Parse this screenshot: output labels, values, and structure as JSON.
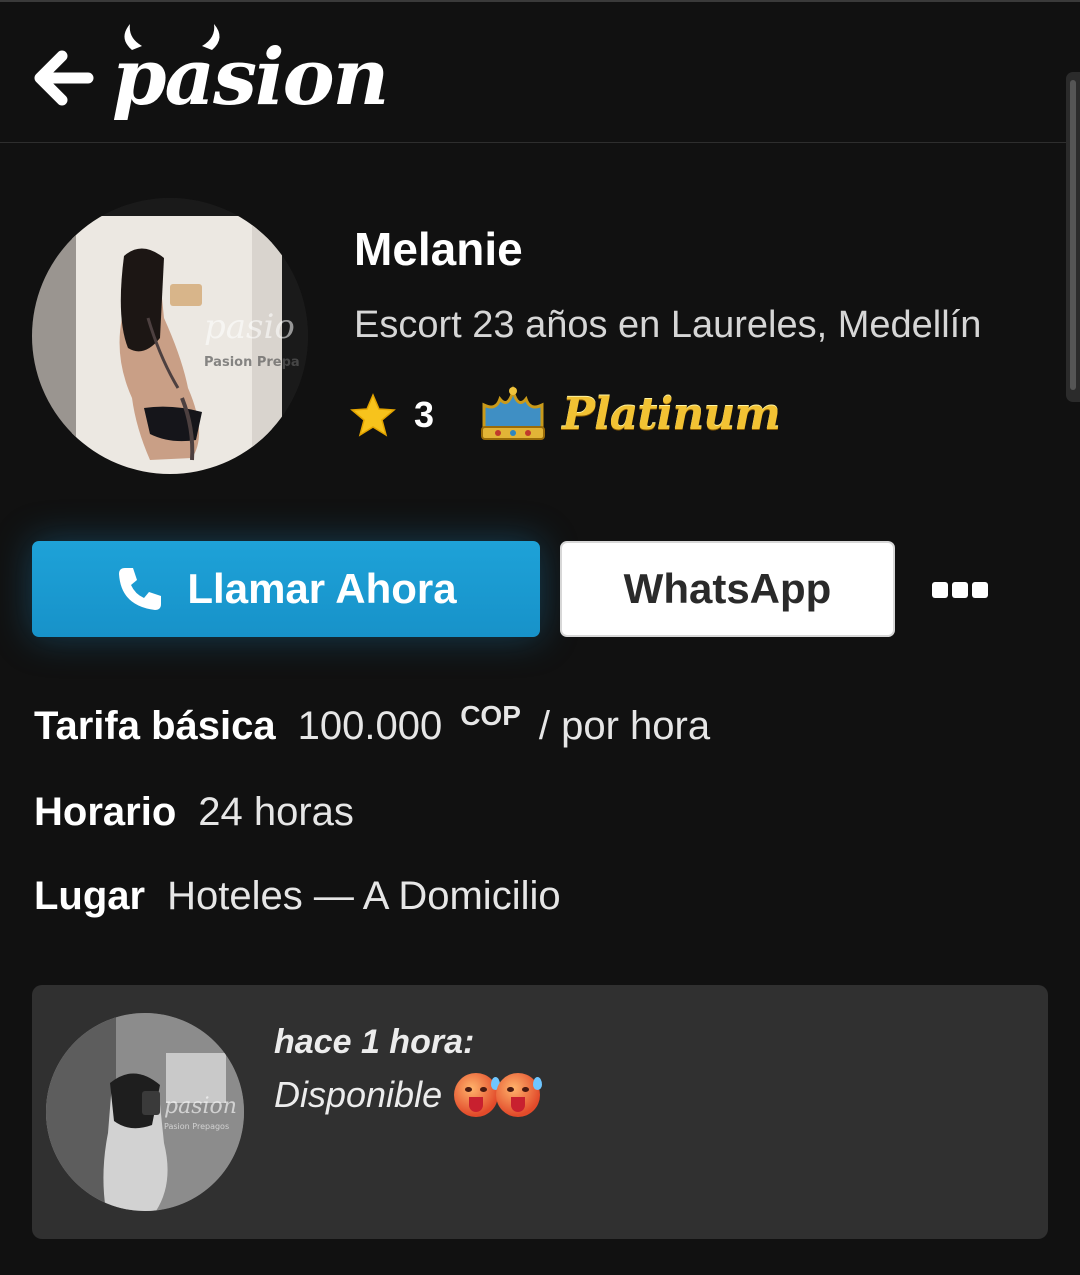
{
  "header": {
    "back_icon": "arrow-left-icon",
    "logo_text": "pasion"
  },
  "profile": {
    "avatar_watermark": "pasio",
    "avatar_watermark_sub": "Pasion Prepa",
    "name": "Melanie",
    "subtitle": "Escort 23 años en Laureles, Medellín",
    "rating": "3",
    "tier": "Platinum",
    "tier_color": "#f2c233"
  },
  "actions": {
    "call_label": "Llamar Ahora",
    "call_icon": "phone-icon",
    "call_color": "#1e9fd6",
    "whatsapp_label": "WhatsApp",
    "more_icon": "more-dots-icon"
  },
  "details": {
    "rate_key": "Tarifa básica",
    "rate_value": "100.000",
    "rate_currency": "COP",
    "rate_unit": "/ por hora",
    "schedule_key": "Horario",
    "schedule_value": "24 horas",
    "place_key": "Lugar",
    "place_value": "Hoteles — A Domicilio"
  },
  "post": {
    "avatar_watermark": "pasion",
    "avatar_watermark_sub": "Pasion Prepagos",
    "time": "hace 1 hora:",
    "text": "Disponible",
    "emoji": "hot-face-emoji"
  }
}
